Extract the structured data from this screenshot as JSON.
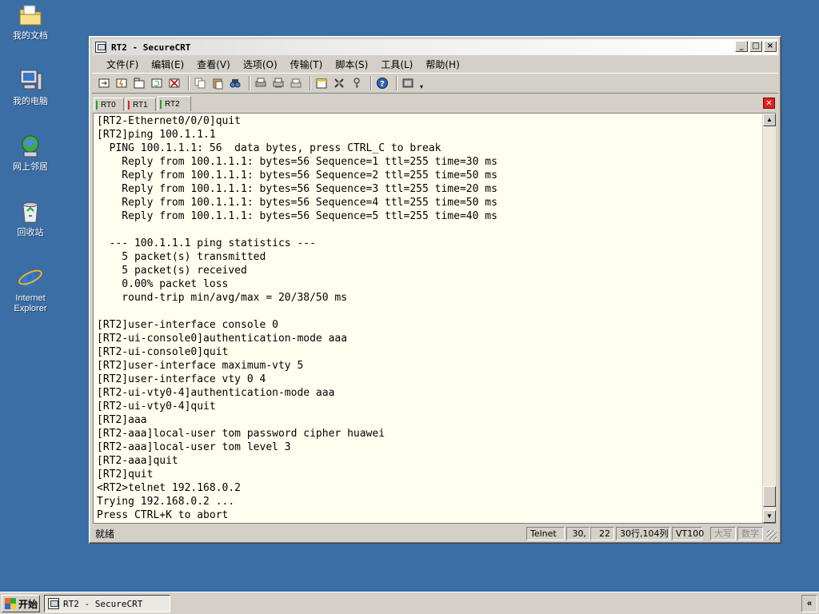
{
  "desktop": {
    "icons": [
      {
        "label": "我的文档",
        "icon": "folder-documents-icon"
      },
      {
        "label": "我的电脑",
        "icon": "my-computer-icon"
      },
      {
        "label": "网上邻居",
        "icon": "network-places-icon"
      },
      {
        "label": "回收站",
        "icon": "recycle-bin-icon"
      },
      {
        "label": "Internet\nExplorer",
        "icon": "internet-explorer-icon"
      }
    ]
  },
  "window": {
    "title": "RT2 - SecureCRT",
    "buttons": {
      "minimize": "_",
      "maximize": "□",
      "close": "×"
    }
  },
  "menu": {
    "items": [
      "文件(F)",
      "编辑(E)",
      "查看(V)",
      "选项(O)",
      "传输(T)",
      "脚本(S)",
      "工具(L)",
      "帮助(H)"
    ]
  },
  "toolbar": {
    "icons": [
      "connect-icon",
      "quick-connect-icon",
      "connect-in-tab-icon",
      "reconnect-icon",
      "disconnect-icon",
      "copy-icon",
      "paste-icon",
      "find-icon",
      "print-icon",
      "print-setup-icon",
      "print-screen-icon",
      "session-options-icon",
      "global-options-icon",
      "keymap-icon",
      "help-icon",
      "sftp-icon"
    ]
  },
  "tabs": [
    {
      "label": "RT0",
      "status_color": "#20a020"
    },
    {
      "label": "RT1",
      "status_color": "#e02020"
    },
    {
      "label": "RT2",
      "status_color": "#20a020",
      "active": true
    }
  ],
  "terminal": {
    "lines": [
      "[RT2-Ethernet0/0/0]quit",
      "[RT2]ping 100.1.1.1",
      "  PING 100.1.1.1: 56  data bytes, press CTRL_C to break",
      "    Reply from 100.1.1.1: bytes=56 Sequence=1 ttl=255 time=30 ms",
      "    Reply from 100.1.1.1: bytes=56 Sequence=2 ttl=255 time=50 ms",
      "    Reply from 100.1.1.1: bytes=56 Sequence=3 ttl=255 time=20 ms",
      "    Reply from 100.1.1.1: bytes=56 Sequence=4 ttl=255 time=50 ms",
      "    Reply from 100.1.1.1: bytes=56 Sequence=5 ttl=255 time=40 ms",
      "",
      "  --- 100.1.1.1 ping statistics ---",
      "    5 packet(s) transmitted",
      "    5 packet(s) received",
      "    0.00% packet loss",
      "    round-trip min/avg/max = 20/38/50 ms",
      "",
      "[RT2]user-interface console 0",
      "[RT2-ui-console0]authentication-mode aaa",
      "[RT2-ui-console0]quit",
      "[RT2]user-interface maximum-vty 5",
      "[RT2]user-interface vty 0 4",
      "[RT2-ui-vty0-4]authentication-mode aaa",
      "[RT2-ui-vty0-4]quit",
      "[RT2]aaa",
      "[RT2-aaa]local-user tom password cipher huawei",
      "[RT2-aaa]local-user tom level 3",
      "[RT2-aaa]quit",
      "[RT2]quit",
      "<RT2>telnet 192.168.0.2",
      "Trying 192.168.0.2 ...",
      "Press CTRL+K to abort"
    ],
    "background": "#fffff0"
  },
  "statusbar": {
    "ready": "就绪",
    "protocol": "Telnet",
    "row": "30,",
    "col": "22",
    "size": "30行,104列",
    "emulation": "VT100",
    "caps": "大写",
    "num": "数字"
  },
  "taskbar": {
    "start_label": "开始",
    "task_label": "RT2 - SecureCRT",
    "tray_label": "«"
  }
}
